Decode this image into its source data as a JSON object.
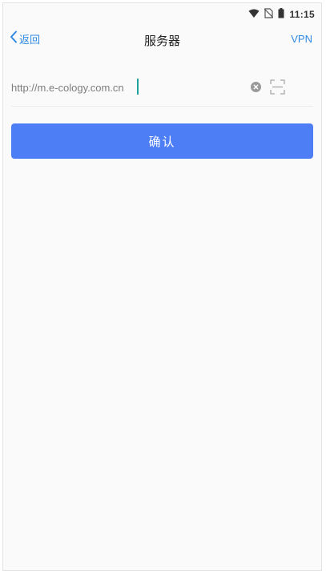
{
  "status_bar": {
    "time": "11:15",
    "icons": [
      "wifi-icon",
      "no-sim-icon",
      "battery-icon"
    ]
  },
  "nav": {
    "back_label": "返回",
    "title": "服务器",
    "right_action": "VPN"
  },
  "server_input": {
    "value": "http://m.e-cology.com.cn",
    "placeholder": ""
  },
  "confirm_label": "确认",
  "colors": {
    "accent_blue": "#2f89e3",
    "button_blue": "#4e7ef6",
    "caret_teal": "#1ea39c"
  }
}
